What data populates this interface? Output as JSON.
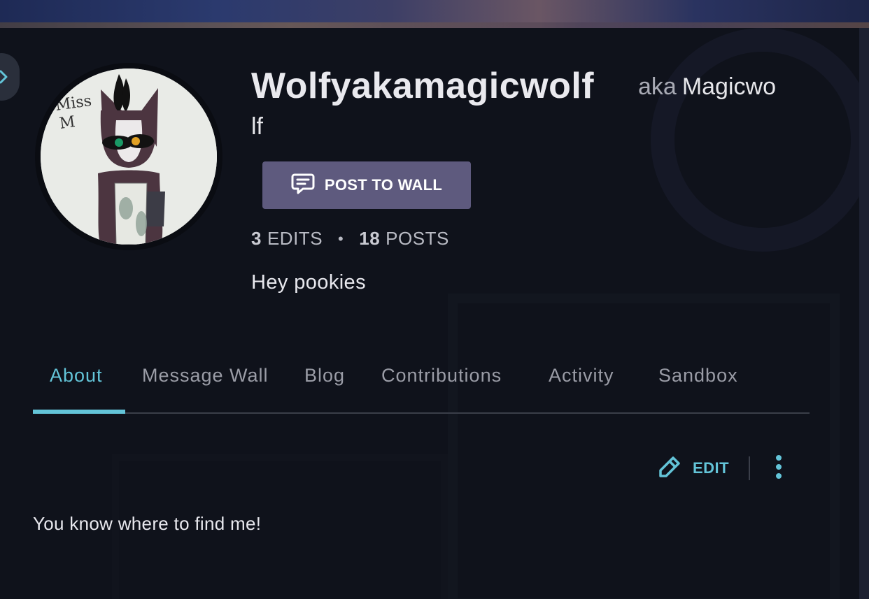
{
  "profile": {
    "username": "Wolfyakamagicwolf",
    "aka_label": "aka",
    "nickname_part1": "Magicwo",
    "nickname_part2": "lf",
    "post_button_label": "POST TO WALL",
    "edits_count": "3",
    "edits_label": "EDITS",
    "posts_count": "18",
    "posts_label": "POSTS",
    "stats_separator": "•",
    "bio": "Hey pookies"
  },
  "tabs": [
    {
      "label": "About",
      "active": true
    },
    {
      "label": "Message Wall",
      "active": false
    },
    {
      "label": "Blog",
      "active": false
    },
    {
      "label": "Contributions",
      "active": false
    },
    {
      "label": "Activity",
      "active": false
    },
    {
      "label": "Sandbox",
      "active": false
    }
  ],
  "about": {
    "edit_label": "EDIT",
    "text": "You know where to find me!"
  },
  "avatar_text": "Miss M",
  "colors": {
    "accent": "#63c4d8",
    "button_bg": "#5e5a7e",
    "panel_bg": "#0f121b"
  },
  "icons": {
    "post_button_icon": "speech-bubble-icon",
    "edit_icon": "pencil-icon",
    "more_icon": "more-vertical-icon",
    "side_toggle_icon": "chevron-right-icon"
  }
}
